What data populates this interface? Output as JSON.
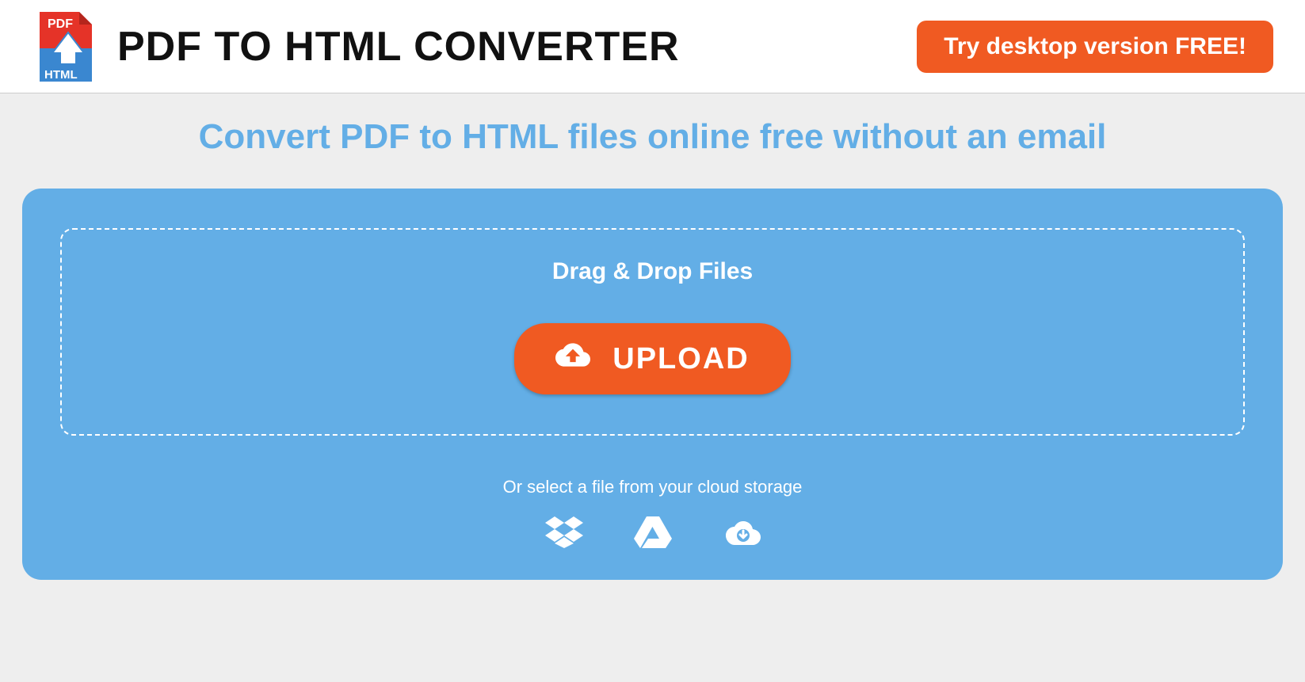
{
  "header": {
    "title": "PDF TO HTML CONVERTER",
    "cta_label": "Try desktop version FREE!"
  },
  "main": {
    "subtitle": "Convert PDF to HTML files online free without an email",
    "drop_text": "Drag & Drop Files",
    "upload_label": "UPLOAD",
    "cloud_text": "Or select a file from your cloud storage"
  },
  "colors": {
    "accent": "#f05a22",
    "panel": "#63aee6"
  }
}
